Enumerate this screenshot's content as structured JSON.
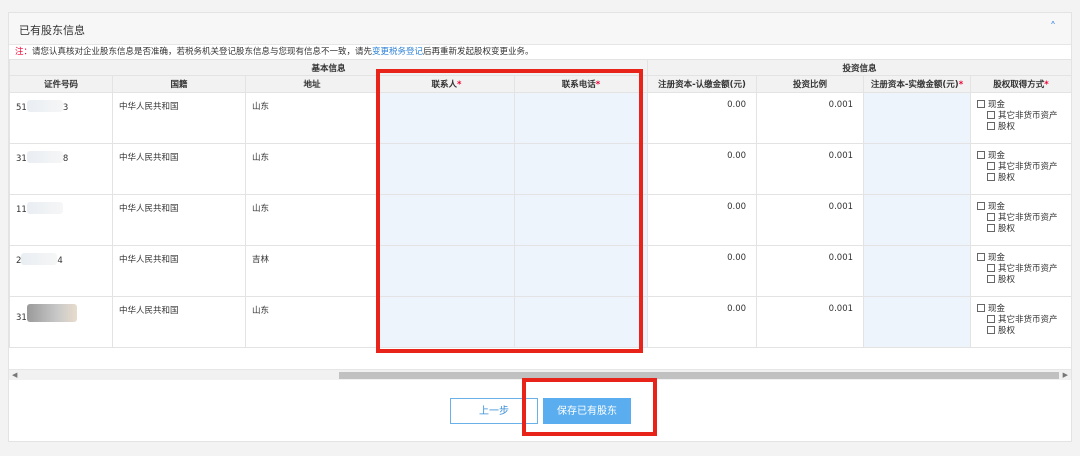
{
  "panel": {
    "title": "已有股东信息",
    "collapse_icon": "chevron-up-icon"
  },
  "notice": {
    "prefix": "注：",
    "text1": "请您认真核对企业股东信息是否准确，若税务机关登记股东信息与您现有信息不一致，请先",
    "link": "变更税务登记",
    "text2": "后再重新发起股权变更业务。"
  },
  "table": {
    "group_headers": {
      "basic": "基本信息",
      "invest": "投资信息"
    },
    "columns": {
      "id_no": "证件号码",
      "nationality": "国籍",
      "address": "地址",
      "contact": "联系人",
      "phone": "联系电话",
      "subscribed": "注册资本-认缴金额(元)",
      "ratio": "投资比例",
      "paid": "注册资本-实缴金额(元)",
      "method": "股权取得方式"
    },
    "required_mark": "*",
    "method_options": [
      "现金",
      "其它非货币资产",
      "股权"
    ],
    "rows": [
      {
        "id_start": "51",
        "id_end": "3",
        "nationality": "中华人民共和国",
        "address": "山东",
        "contact": "",
        "phone": "",
        "subscribed": "0.00",
        "ratio": "0.001",
        "paid": ""
      },
      {
        "id_start": "31",
        "id_end": "8",
        "nationality": "中华人民共和国",
        "address": "山东",
        "contact": "",
        "phone": "",
        "subscribed": "0.00",
        "ratio": "0.001",
        "paid": ""
      },
      {
        "id_start": "11",
        "id_end": "",
        "nationality": "中华人民共和国",
        "address": "山东",
        "contact": "",
        "phone": "",
        "subscribed": "0.00",
        "ratio": "0.001",
        "paid": ""
      },
      {
        "id_start": "2",
        "id_end": "4",
        "nationality": "中华人民共和国",
        "address": "吉林",
        "contact": "",
        "phone": "",
        "subscribed": "0.00",
        "ratio": "0.001",
        "paid": ""
      },
      {
        "id_start": "31",
        "id_end": "",
        "nationality": "中华人民共和国",
        "address": "山东",
        "contact": "",
        "phone": "",
        "subscribed": "0.00",
        "ratio": "0.001",
        "paid": ""
      }
    ]
  },
  "buttons": {
    "prev": "上一步",
    "save": "保存已有股东"
  },
  "colors": {
    "highlight": "#e8231a",
    "primary": "#5aaef0",
    "link": "#2a7fd4",
    "required": "#e03"
  }
}
